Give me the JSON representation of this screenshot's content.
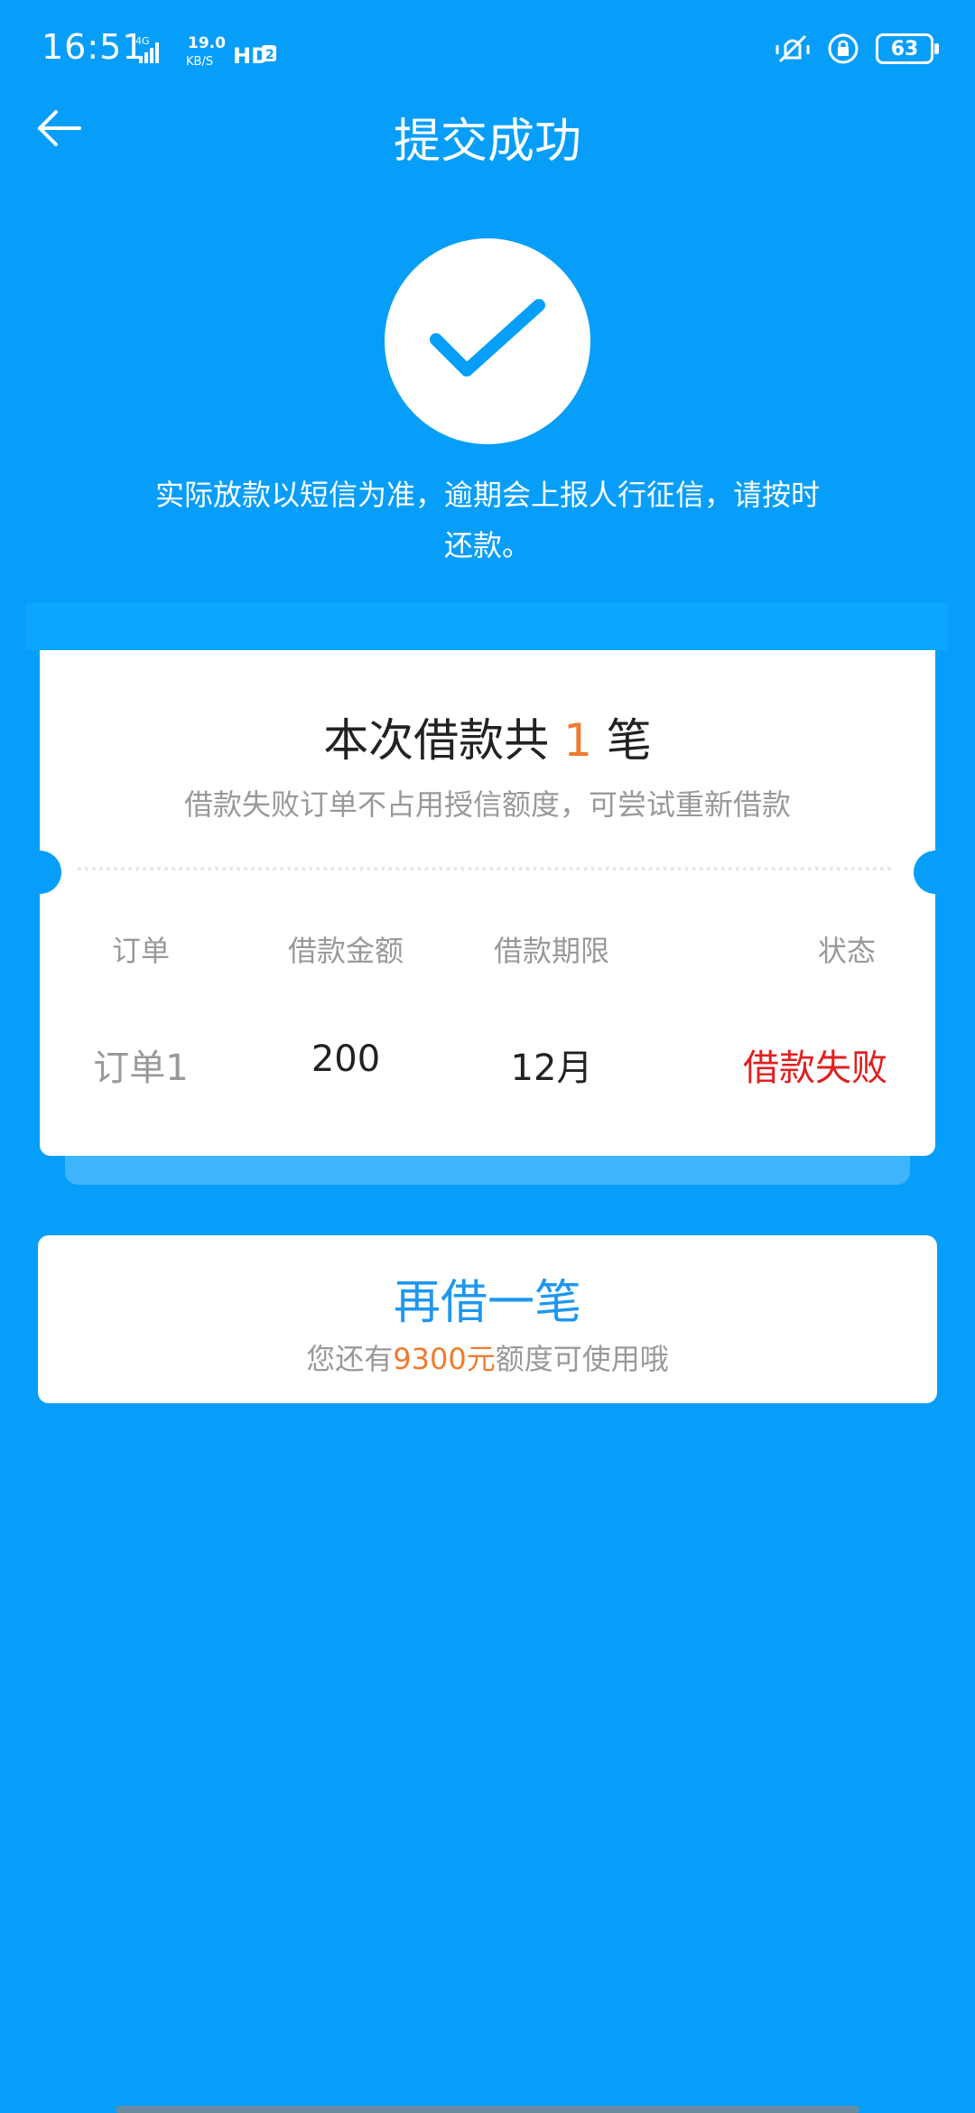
{
  "status_bar": {
    "time": "16:51",
    "network": "4G",
    "speed_value": "19.0",
    "speed_unit": "KB/S",
    "hd": "HD",
    "hd_badge": "2",
    "battery": "63"
  },
  "header": {
    "title": "提交成功"
  },
  "notice": {
    "line1": "实际放款以短信为准，逾期会上报人行征信，请按时",
    "line2": "还款。"
  },
  "ticket": {
    "title_prefix": "本次借款共 ",
    "title_count": "1",
    "title_suffix": " 笔",
    "subtitle": "借款失败订单不占用授信额度，可尝试重新借款",
    "headers": {
      "order": "订单",
      "amount": "借款金额",
      "term": "借款期限",
      "status": "状态"
    },
    "rows": [
      {
        "order": "订单1",
        "amount": "200",
        "term": "12月",
        "status": "借款失败"
      }
    ]
  },
  "again": {
    "title": "再借一笔",
    "sub_prefix": "您还有",
    "sub_amount": "9300元",
    "sub_suffix": "额度可使用哦"
  },
  "colors": {
    "background": "#079ef9",
    "accent_orange": "#f07a2e",
    "status_fail": "#e02020",
    "title_blue": "#1f97ef"
  }
}
